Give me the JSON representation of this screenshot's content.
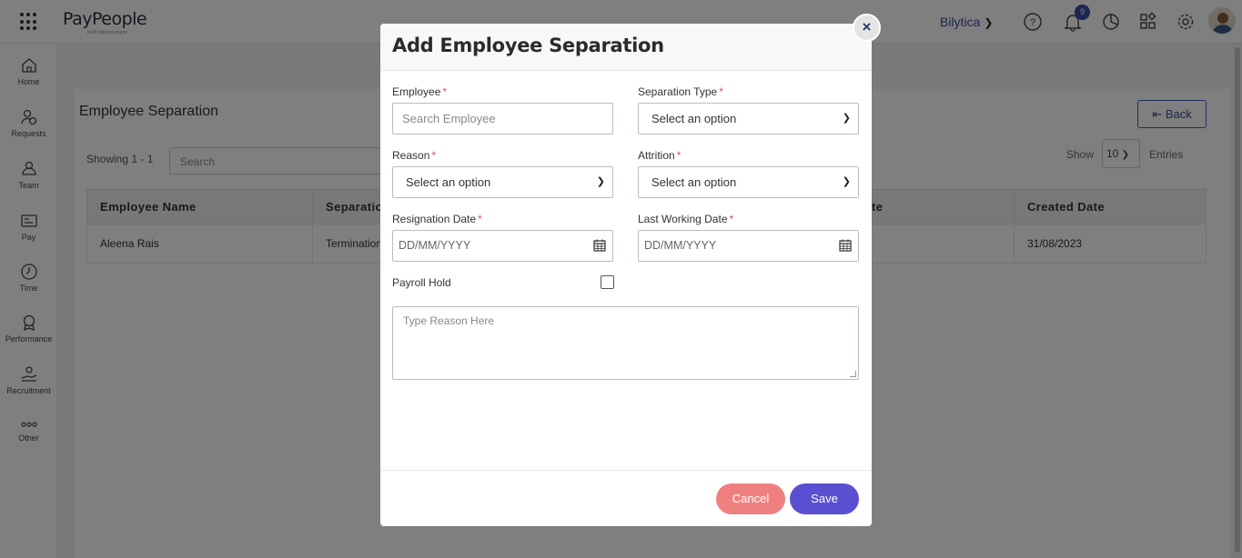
{
  "header": {
    "logo": "PayPeople",
    "logo_tagline": "build winning teams",
    "company": "Bilytica",
    "notification_count": "9"
  },
  "sidebar": {
    "items": [
      {
        "label": "Home",
        "icon": "home-icon"
      },
      {
        "label": "Requests",
        "icon": "requests-icon"
      },
      {
        "label": "Team",
        "icon": "team-icon"
      },
      {
        "label": "Pay",
        "icon": "pay-icon"
      },
      {
        "label": "Time",
        "icon": "clock-icon"
      },
      {
        "label": "Performance",
        "icon": "award-icon"
      },
      {
        "label": "Recruitment",
        "icon": "recruitment-icon"
      },
      {
        "label": "Other",
        "icon": "more-icon"
      }
    ]
  },
  "page": {
    "title": "Employee Separation",
    "back_label": "Back",
    "showing": "Showing 1 - 1",
    "search_placeholder": "Search",
    "show_label": "Show",
    "entries_value": "10",
    "entries_label": "Entries",
    "table": {
      "headers": [
        "Employee Name",
        "Separation",
        "te",
        "Created Date"
      ],
      "rows": [
        [
          "Aleena Rais",
          "Termination",
          "",
          "31/08/2023"
        ]
      ]
    }
  },
  "modal": {
    "title": "Add Employee Separation",
    "fields": {
      "employee": {
        "label": "Employee",
        "placeholder": "Search Employee"
      },
      "separation_type": {
        "label": "Separation Type",
        "value": "Select an option"
      },
      "reason": {
        "label": "Reason",
        "value": "Select an option"
      },
      "attrition": {
        "label": "Attrition",
        "value": "Select an option"
      },
      "resignation_date": {
        "label": "Resignation Date",
        "placeholder": "DD/MM/YYYY"
      },
      "last_working_date": {
        "label": "Last Working Date",
        "placeholder": "DD/MM/YYYY"
      },
      "payroll_hold": {
        "label": "Payroll Hold",
        "checked": false
      },
      "reason_text": {
        "placeholder": "Type Reason Here"
      }
    },
    "required_mark": "*",
    "cancel_label": "Cancel",
    "save_label": "Save",
    "close_symbol": "×"
  },
  "colors": {
    "accent": "#5a4fd0",
    "cancel": "#f08080",
    "brand_blue": "#3a4a9c",
    "required": "#d9534f"
  }
}
